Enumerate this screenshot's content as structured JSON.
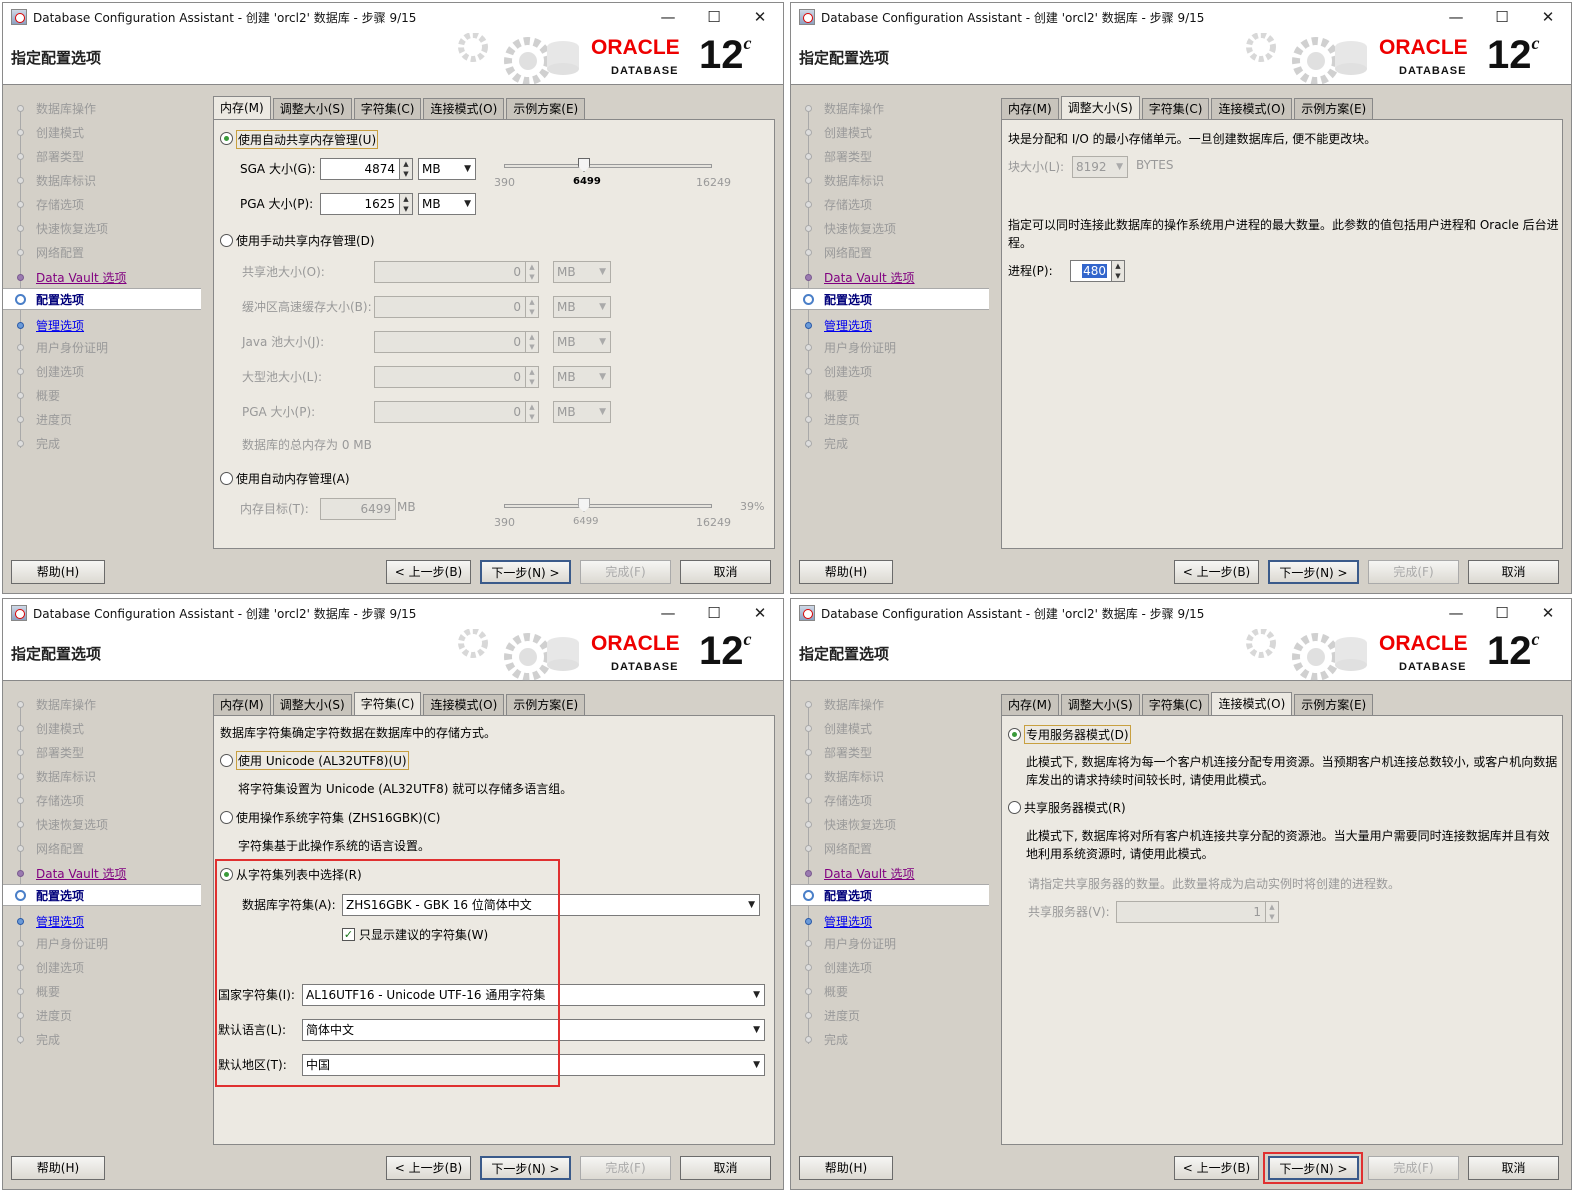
{
  "window_title": "Database Configuration Assistant - 创建 'orcl2' 数据库 - 步骤 9/15",
  "window_controls": {
    "min": "—",
    "max": "☐",
    "close": "✕"
  },
  "header_title": "指定配置选项",
  "logo": {
    "oracle": "ORACLE",
    "database": "DATABASE",
    "version": "12",
    "version_sup": "c"
  },
  "sidebar": [
    "数据库操作",
    "创建模式",
    "部署类型",
    "数据库标识",
    "存储选项",
    "快速恢复选项",
    "网络配置",
    "Data Vault 选项",
    "配置选项",
    "管理选项",
    "用户身份证明",
    "创建选项",
    "概要",
    "进度页",
    "完成"
  ],
  "tabs": [
    "内存(M)",
    "调整大小(S)",
    "字符集(C)",
    "连接模式(O)",
    "示例方案(E)"
  ],
  "buttons": {
    "help": "帮助(H)",
    "back": "< 上一步(B)",
    "next": "下一步(N) >",
    "finish": "完成(F)",
    "cancel": "取消"
  },
  "memory": {
    "auto_shared": "使用自动共享内存管理(U)",
    "sga_label": "SGA 大小(G):",
    "sga_value": "4874",
    "sga_unit": "MB",
    "pga_label": "PGA 大小(P):",
    "pga_value": "1625",
    "pga_unit": "MB",
    "slider_min": "390",
    "slider_val": "6499",
    "slider_max": "16249",
    "manual_shared": "使用手动共享内存管理(D)",
    "manual_fields": [
      {
        "label": "共享池大小(O):",
        "value": "0",
        "unit": "MB"
      },
      {
        "label": "缓冲区高速缓存大小(B):",
        "value": "0",
        "unit": "MB"
      },
      {
        "label": "Java 池大小(J):",
        "value": "0",
        "unit": "MB"
      },
      {
        "label": "大型池大小(L):",
        "value": "0",
        "unit": "MB"
      },
      {
        "label": "PGA 大小(P):",
        "value": "0",
        "unit": "MB"
      }
    ],
    "total": "数据库的总内存为 0 MB",
    "auto_mem": "使用自动内存管理(A)",
    "target_label": "内存目标(T):",
    "target_value": "6499",
    "target_unit": "MB",
    "t_min": "390",
    "t_val": "6499",
    "t_max": "16249",
    "t_pct": "39%"
  },
  "sizing": {
    "block_desc": "块是分配和 I/O 的最小存储单元。一旦创建数据库后, 便不能更改块。",
    "block_label": "块大小(L):",
    "block_value": "8192",
    "block_unit": "BYTES",
    "proc_desc_1": "指定可以同时连接此数据库的操作系统用户进程的最大数量。此参数的值包括用户进程和 Oracle 后台进",
    "proc_desc_2": "程。",
    "proc_label": "进程(P):",
    "proc_value": "480"
  },
  "charset": {
    "desc": "数据库字符集确定字符数据在数据库中的存储方式。",
    "unicode": "使用 Unicode (AL32UTF8)(U)",
    "unicode_desc": "将字符集设置为 Unicode (AL32UTF8) 就可以存储多语言组。",
    "os": "使用操作系统字符集 (ZHS16GBK)(C)",
    "os_desc": "字符集基于此操作系统的语言设置。",
    "list": "从字符集列表中选择(R)",
    "db_cs_label": "数据库字符集(A):",
    "db_cs_value": "ZHS16GBK - GBK 16 位简体中文",
    "show_recommended": "只显示建议的字符集(W)",
    "national_label": "国家字符集(I):",
    "national_value": "AL16UTF16 - Unicode UTF-16 通用字符集",
    "lang_label": "默认语言(L):",
    "lang_value": "简体中文",
    "terr_label": "默认地区(T):",
    "terr_value": "中国"
  },
  "connection": {
    "dedicated": "专用服务器模式(D)",
    "dedicated_desc_1": "此模式下, 数据库将为每一个客户机连接分配专用资源。当预期客户机连接总数较小, 或客户机向数据",
    "dedicated_desc_2": "库发出的请求持续时间较长时, 请使用此模式。",
    "shared": "共享服务器模式(R)",
    "shared_desc_1": "此模式下, 数据库将对所有客户机连接共享分配的资源池。当大量用户需要同时连接数据库并且有效",
    "shared_desc_2": "地利用系统资源时, 请使用此模式。",
    "shared_hint": "请指定共享服务器的数量。此数量将成为启动实例时将创建的进程数。",
    "shared_label": "共享服务器(V):",
    "shared_value": "1"
  },
  "colors": {
    "highlight_box": "#e03030",
    "oracle_red": "#e00000",
    "link": "#0000ee"
  }
}
